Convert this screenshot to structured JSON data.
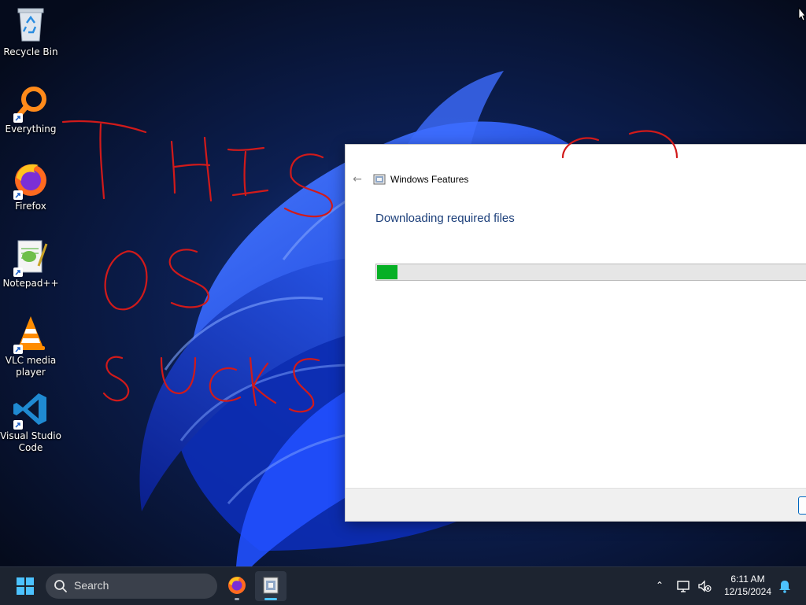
{
  "desktop": {
    "icons": [
      {
        "name": "recycle-bin-icon",
        "label": "Recycle Bin"
      },
      {
        "name": "everything-icon",
        "label": "Everything"
      },
      {
        "name": "firefox-icon",
        "label": "Firefox"
      },
      {
        "name": "notepadpp-icon",
        "label": "Notepad++"
      },
      {
        "name": "vlc-icon",
        "label": "VLC media player"
      },
      {
        "name": "vscode-icon",
        "label": "Visual Studio Code"
      }
    ]
  },
  "dialog": {
    "title": "Windows Features",
    "heading": "Downloading required files",
    "progress_percent": 5
  },
  "taskbar": {
    "search_label": "Search",
    "time": "6:11 AM",
    "date": "12/15/2024",
    "pinned": [
      {
        "name": "firefox-taskbar-icon"
      },
      {
        "name": "windows-features-taskbar-icon"
      }
    ]
  },
  "colors": {
    "accent": "#0067c0",
    "progress": "#06b025",
    "scribble": "#d11a1a",
    "heading": "#1c3f7a"
  }
}
